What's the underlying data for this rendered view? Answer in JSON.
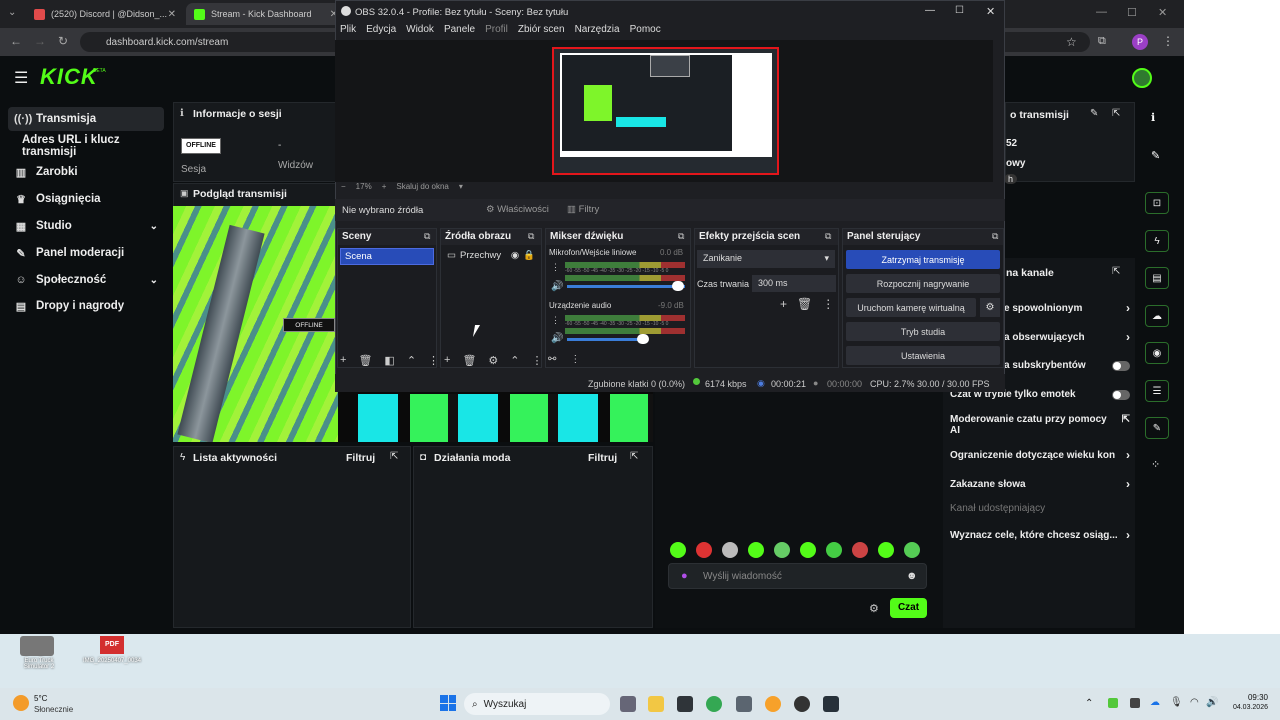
{
  "browser": {
    "tabs": [
      {
        "label": "(2520) Discord | @Didson_..."
      },
      {
        "label": "Stream - Kick Dashboard"
      }
    ],
    "url": "dashboard.kick.com/stream",
    "profile_initial": "P"
  },
  "kick": {
    "logo": "KICK",
    "logo_badge": "BETA",
    "sidebar": [
      {
        "label": "Transmisja",
        "icon": "broadcast-icon"
      },
      {
        "label": "Adres URL i klucz transmisji",
        "icon": ""
      },
      {
        "label": "Zarobki",
        "icon": "earnings-icon"
      },
      {
        "label": "Osiągnięcia",
        "icon": "trophy-icon"
      },
      {
        "label": "Studio",
        "icon": "studio-icon"
      },
      {
        "label": "Panel moderacji",
        "icon": "wrench-icon"
      },
      {
        "label": "Społeczność",
        "icon": "community-icon"
      },
      {
        "label": "Dropy i nagrody",
        "icon": "gift-icon"
      }
    ],
    "session": {
      "title": "Informacje o sesji",
      "status": "OFFLINE",
      "session_label": "Sesja",
      "viewers_label": "Widzów",
      "viewers_value": "-"
    },
    "preview": {
      "title": "Podgląd transmisji",
      "badge": "OFFLINE"
    },
    "activity": {
      "title": "Lista aktywności",
      "filter": "Filtruj"
    },
    "mod": {
      "title": "Działania moda",
      "filter": "Filtruj"
    },
    "chat": {
      "placeholder": "Wyślij wiadomość",
      "send": "Czat"
    },
    "right_panel": {
      "session_title": "o transmisji",
      "partial1": "52",
      "partial2": "owy",
      "partial3": "h",
      "channel_title": "na kanale",
      "rows": [
        {
          "label": "e spowolnionym",
          "type": "chevron"
        },
        {
          "label": "a obserwujących",
          "type": "chevron"
        },
        {
          "label": "a subskrybentów",
          "type": "toggle"
        },
        {
          "label": "Czat w trybie tylko emotek",
          "type": "toggle"
        },
        {
          "label": "Moderowanie czatu przy pomocy AI",
          "type": "link"
        },
        {
          "label": "Ograniczenie dotyczące wieku kon",
          "type": "chevron"
        },
        {
          "label": "Zakazane słowa",
          "type": "chevron"
        },
        {
          "label": "Kanał udostępniający",
          "type": "none"
        },
        {
          "label": "Wyznacz cele, które chcesz osiąg...",
          "type": "chevron"
        }
      ]
    }
  },
  "obs": {
    "title": "OBS 32.0.4 - Profile: Bez tytułu - Sceny: Bez tytułu",
    "menu": [
      "Plik",
      "Edycja",
      "Widok",
      "Panele",
      "Profil",
      "Zbiór scen",
      "Narzędzia",
      "Pomoc"
    ],
    "zoom": "17%",
    "zoom_mode": "Skaluj do okna",
    "no_source": "Nie wybrano źródła",
    "properties": "Właściwości",
    "filters": "Filtry",
    "scenes": {
      "title": "Sceny",
      "items": [
        "Scena"
      ]
    },
    "sources": {
      "title": "Źródła obrazu",
      "items": [
        "Przechwy"
      ]
    },
    "mixer": {
      "title": "Mikser dźwięku",
      "channels": [
        {
          "name": "Mikrofon/Wejście liniowe",
          "db": "0.0 dB",
          "level": 0.82
        },
        {
          "name": "Urządzenie audio",
          "db": "-9.0 dB",
          "level": 0.6
        }
      ],
      "scale": "-60 -55 -50 -45 -40 -35 -30 -25 -20 -15 -10 -5 0"
    },
    "transitions": {
      "title": "Efekty przejścia scen",
      "selected": "Zanikanie",
      "duration_label": "Czas trwania",
      "duration": "300 ms"
    },
    "controls": {
      "title": "Panel sterujący",
      "buttons": [
        "Zatrzymaj transmisję",
        "Rozpocznij nagrywanie",
        "Uruchom kamerę wirtualną",
        "Tryb studia",
        "Ustawienia"
      ]
    },
    "status": {
      "dropped": "Zgubione klatki 0 (0.0%)",
      "bitrate": "6174 kbps",
      "live_time": "00:00:21",
      "rec_time": "00:00:00",
      "cpu": "CPU: 2.7%",
      "fps": "30.00 / 30.00 FPS"
    }
  },
  "desktop": {
    "icons": [
      {
        "label": "Euro Truck Simulator 2"
      },
      {
        "label": "IMG_20250407_0034"
      }
    ]
  },
  "taskbar": {
    "weather_temp": "5°C",
    "weather_desc": "Słonecznie",
    "search": "Wyszukaj",
    "time": "09:30",
    "date": "04.03.2026"
  },
  "colors": {
    "kick_green": "#53fc18",
    "obs_accent": "#284cb8",
    "rec_red": "#e3161b"
  }
}
